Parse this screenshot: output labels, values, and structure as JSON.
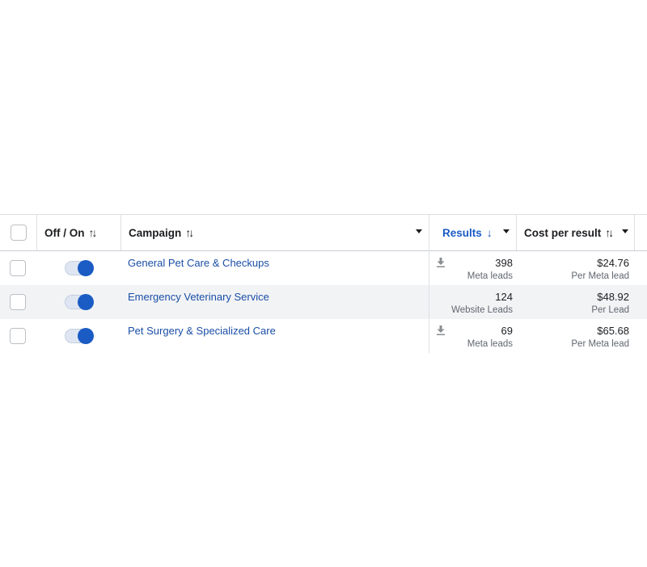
{
  "header": {
    "off_on_label": "Off / On",
    "campaign_label": "Campaign",
    "results_label": "Results",
    "cost_label": "Cost per result",
    "sort_glyph": "↑↓",
    "results_sort_glyph": "↓"
  },
  "rows": [
    {
      "campaign": "General Pet Care & Checkups",
      "results": "398",
      "results_type": "Meta leads",
      "cost": "$24.76",
      "cost_type": "Per Meta lead",
      "has_download_icon": true,
      "toggle_on": true
    },
    {
      "campaign": "Emergency Veterinary Service",
      "results": "124",
      "results_type": "Website Leads",
      "cost": "$48.92",
      "cost_type": "Per Lead",
      "has_download_icon": false,
      "toggle_on": true
    },
    {
      "campaign": "Pet Surgery & Specialized Care",
      "results": "69",
      "results_type": "Meta leads",
      "cost": "$65.68",
      "cost_type": "Per Meta lead",
      "has_download_icon": true,
      "toggle_on": true
    }
  ],
  "colors": {
    "accent_blue": "#1a5bc4",
    "link_blue": "#1a4ea6",
    "results_header_blue": "#1a5bc4",
    "alt_row_bg": "#f2f3f5"
  },
  "icons": {
    "download": "download-icon",
    "sort": "sort-arrows-icon",
    "dropdown": "caret-down-icon"
  }
}
